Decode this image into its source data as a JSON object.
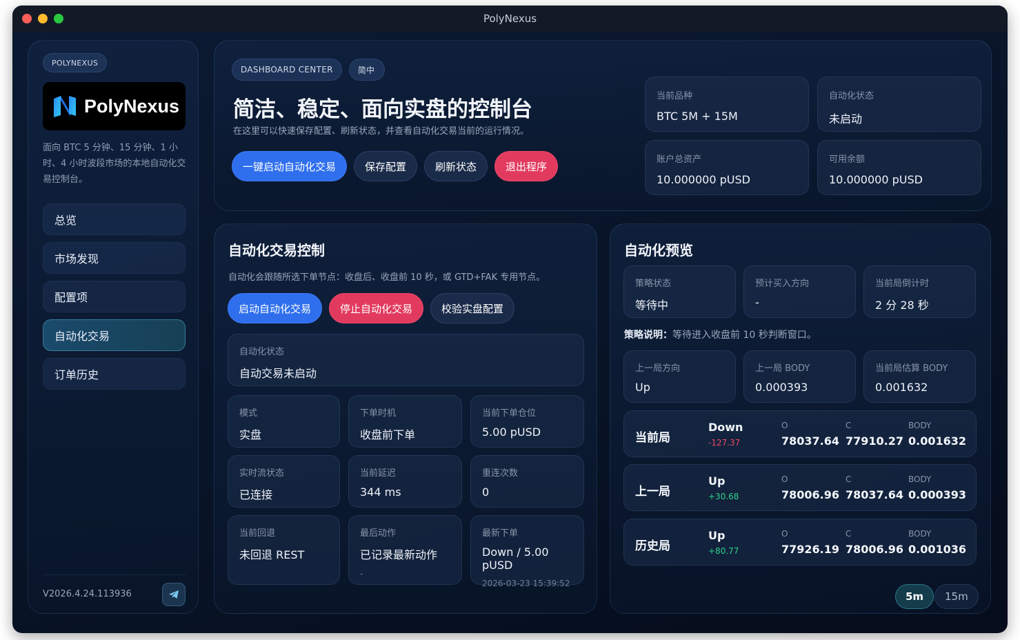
{
  "window": {
    "title": "PolyNexus"
  },
  "sidebar": {
    "brand_pill": "POLYNEXUS",
    "logo_text": "PolyNexus",
    "description": "面向 BTC 5 分钟、15 分钟、1 小时、4 小时波段市场的本地自动化交易控制台。",
    "items": [
      {
        "label": "总览"
      },
      {
        "label": "市场发现"
      },
      {
        "label": "配置项"
      },
      {
        "label": "自动化交易"
      },
      {
        "label": "订单历史"
      }
    ],
    "version": "V2026.4.24.113936"
  },
  "header": {
    "tag": "DASHBOARD CENTER",
    "lang": "简中",
    "title": "简洁、稳定、面向实盘的控制台",
    "subtitle": "在这里可以快速保存配置、刷新状态，并查看自动化交易当前的运行情况。",
    "buttons": {
      "start": "一键启动自动化交易",
      "save": "保存配置",
      "refresh": "刷新状态",
      "exit": "退出程序"
    },
    "stats": [
      {
        "label": "当前品种",
        "value": "BTC 5M + 15M"
      },
      {
        "label": "自动化状态",
        "value": "未启动"
      },
      {
        "label": "账户总资产",
        "value": "10.000000 pUSD"
      },
      {
        "label": "可用余额",
        "value": "10.000000 pUSD"
      }
    ]
  },
  "control": {
    "title": "自动化交易控制",
    "desc": "自动化会跟随所选下单节点：收盘后、收盘前 10 秒，或 GTD+FAK 专用节点。",
    "buttons": {
      "start": "启动自动化交易",
      "stop": "停止自动化交易",
      "verify": "校验实盘配置"
    },
    "status": {
      "label": "自动化状态",
      "value": "自动交易未启动"
    },
    "tiles": [
      {
        "label": "模式",
        "value": "实盘"
      },
      {
        "label": "下单时机",
        "value": "收盘前下单"
      },
      {
        "label": "当前下单仓位",
        "value": "5.00 pUSD"
      },
      {
        "label": "实时流状态",
        "value": "已连接"
      },
      {
        "label": "当前延迟",
        "value": "344 ms"
      },
      {
        "label": "重连次数",
        "value": "0"
      },
      {
        "label": "当前回退",
        "value": "未回退 REST"
      },
      {
        "label": "最后动作",
        "value": "已记录最新动作",
        "sub": "-"
      },
      {
        "label": "最新下单",
        "value": "Down / 5.00 pUSD",
        "sub": "2026-03-23 15:39:52"
      }
    ]
  },
  "preview": {
    "title": "自动化预览",
    "tiles": [
      {
        "label": "策略状态",
        "value": "等待中"
      },
      {
        "label": "预计买入方向",
        "value": "-"
      },
      {
        "label": "当前局倒计时",
        "value": "2 分 28 秒"
      },
      {
        "label": "上一局方向",
        "value": "Up"
      },
      {
        "label": "上一局 BODY",
        "value": "0.000393"
      },
      {
        "label": "当前局估算 BODY",
        "value": "0.001632"
      }
    ],
    "note_label": "策略说明：",
    "note_text": "等待进入收盘前 10 秒判断窗口。",
    "col_labels": {
      "o": "O",
      "c": "C",
      "body": "BODY"
    },
    "rounds": [
      {
        "name": "当前局",
        "direction": "Down",
        "change": "-127.37",
        "o": "78037.64",
        "c": "77910.27",
        "body": "0.001632"
      },
      {
        "name": "上一局",
        "direction": "Up",
        "change": "+30.68",
        "o": "78006.96",
        "c": "78037.64",
        "body": "0.000393"
      },
      {
        "name": "历史局",
        "direction": "Up",
        "change": "+80.77",
        "o": "77926.19",
        "c": "78006.96",
        "body": "0.001036"
      }
    ],
    "timeframes": [
      "5m",
      "15m"
    ],
    "active_timeframe": "5m"
  },
  "colors": {
    "accent_blue": "#2f6fed",
    "danger_red": "#e23a5e",
    "positive": "#2fd18a",
    "negative": "#f04769"
  },
  "icons": {
    "telegram": "telegram-icon",
    "logo": "polynexus-logo-icon"
  }
}
